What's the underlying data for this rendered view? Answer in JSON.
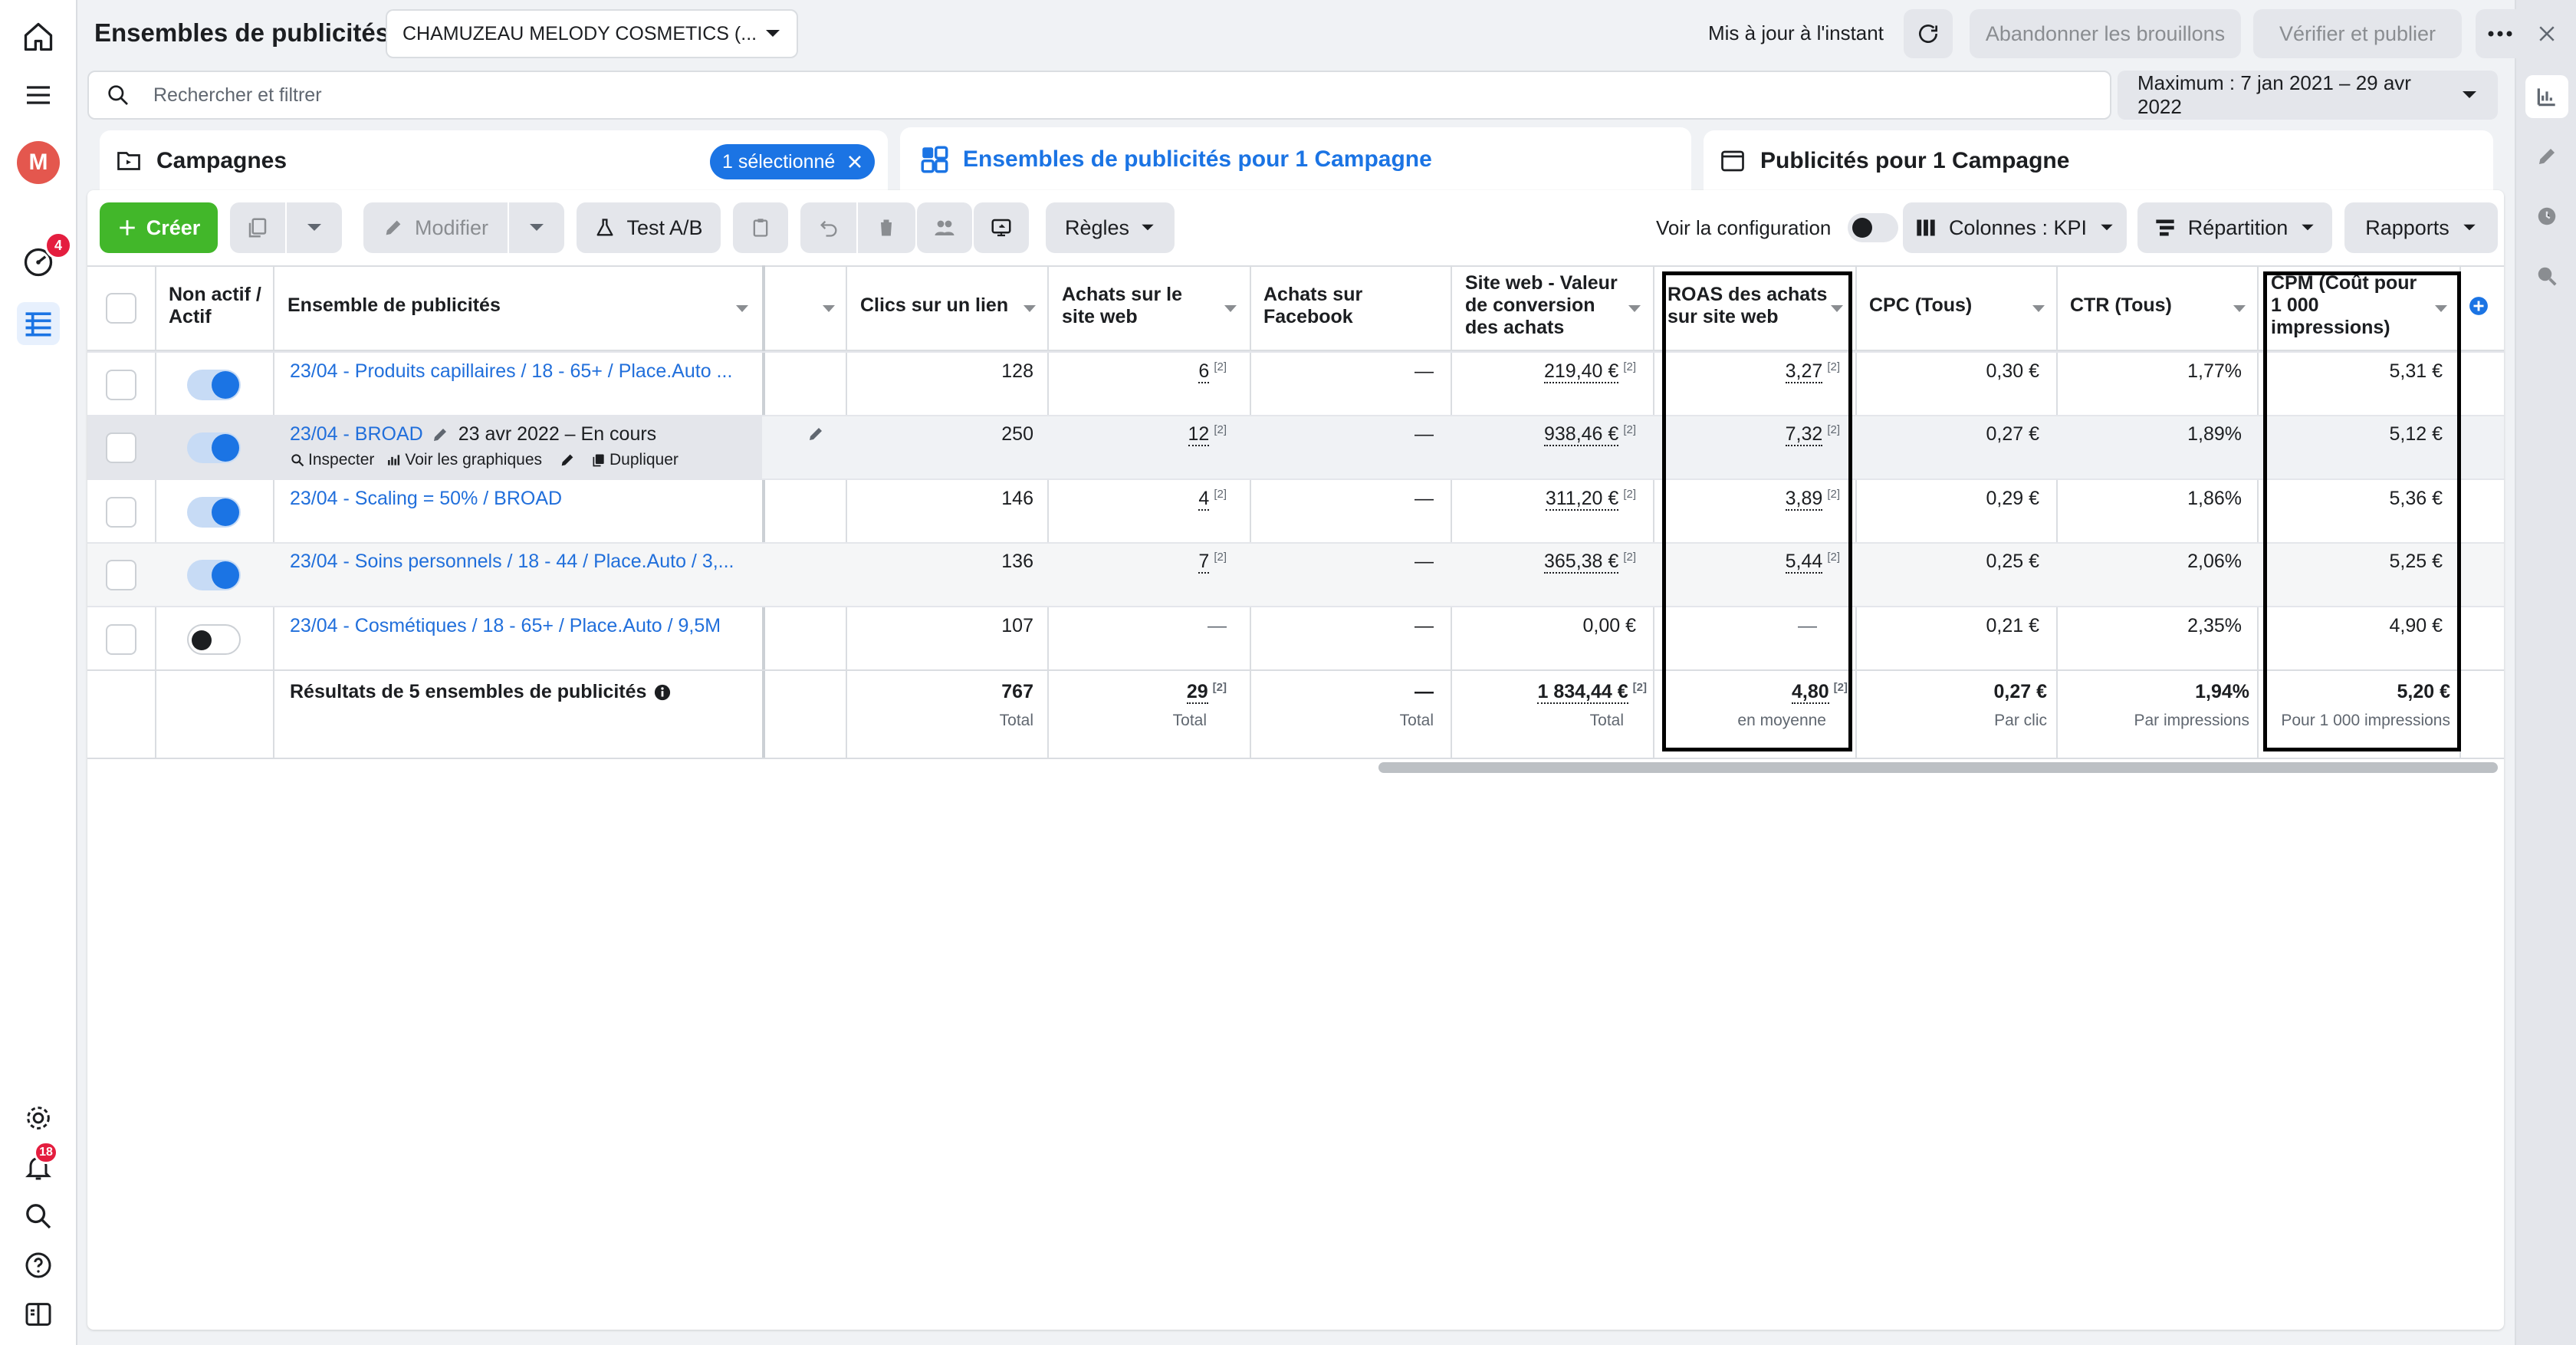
{
  "header": {
    "title": "Ensembles de publicités",
    "account": "CHAMUZEAU MELODY COSMETICS (...",
    "updated": "Mis à jour à l'instant",
    "discard": "Abandonner les brouillons",
    "review": "Vérifier et publier"
  },
  "search": {
    "placeholder": "Rechercher et filtrer",
    "date_range": "Maximum : 7 jan 2021 – 29 avr 2022"
  },
  "leftnav": {
    "avatar": "M",
    "badge_ads": "4",
    "badge_notif": "18"
  },
  "tabs": {
    "campaigns": "Campagnes",
    "selected_badge": "1 sélectionné",
    "adsets": "Ensembles de publicités pour 1 Campagne",
    "ads": "Publicités pour 1 Campagne"
  },
  "toolbar": {
    "create": "Créer",
    "edit": "Modifier",
    "abtest": "Test A/B",
    "rules": "Règles",
    "view_config": "Voir la configuration",
    "columns": "Colonnes : KPI",
    "breakdown": "Répartition",
    "reports": "Rapports"
  },
  "columns": {
    "status": "Non actif / Actif",
    "name": "Ensemble de publicités",
    "clicks": "Clics sur un lien",
    "purchases_web": "Achats sur le site web",
    "purchases_fb": "Achats sur Facebook",
    "conv_value": "Site web - Valeur de conversion des achats",
    "roas": "ROAS des achats sur site web",
    "cpc": "CPC (Tous)",
    "ctr": "CTR (Tous)",
    "cpm": "CPM (Coût pour 1 000 impressions)"
  },
  "rows": [
    {
      "name": "23/04 - Produits capillaires / 18 - 65+ / Place.Auto ...",
      "active": true,
      "clicks": "128",
      "purchases_web": "6",
      "purchases_fb": "—",
      "conv_value": "219,40 €",
      "roas": "3,27",
      "cpc": "0,30 €",
      "ctr": "1,77%",
      "cpm": "5,31 €"
    },
    {
      "name": "23/04 - BROAD",
      "date": "23 avr 2022 – En cours",
      "active": true,
      "clicks": "250",
      "purchases_web": "12",
      "purchases_fb": "—",
      "conv_value": "938,46 €",
      "roas": "7,32",
      "cpc": "0,27 €",
      "ctr": "1,89%",
      "cpm": "5,12 €"
    },
    {
      "name": "23/04 - Scaling = 50% / BROAD",
      "active": true,
      "clicks": "146",
      "purchases_web": "4",
      "purchases_fb": "—",
      "conv_value": "311,20 €",
      "roas": "3,89",
      "cpc": "0,29 €",
      "ctr": "1,86%",
      "cpm": "5,36 €"
    },
    {
      "name": "23/04 - Soins personnels / 18 - 44 / Place.Auto / 3,...",
      "active": true,
      "clicks": "136",
      "purchases_web": "7",
      "purchases_fb": "—",
      "conv_value": "365,38 €",
      "roas": "5,44",
      "cpc": "0,25 €",
      "ctr": "2,06%",
      "cpm": "5,25 €"
    },
    {
      "name": "23/04 - Cosmétiques / 18 - 65+ / Place.Auto / 9,5M",
      "active": false,
      "clicks": "107",
      "purchases_web": "—",
      "purchases_fb": "—",
      "conv_value": "0,00 €",
      "roas": "—",
      "cpc": "0,21 €",
      "ctr": "2,35%",
      "cpm": "4,90 €"
    }
  ],
  "row_actions": {
    "inspect": "Inspecter",
    "charts": "Voir les graphiques",
    "duplicate": "Dupliquer"
  },
  "footnote": "[2]",
  "totals": {
    "label": "Résultats de 5 ensembles de publicités",
    "clicks": "767",
    "clicks_sub": "Total",
    "purchases_web": "29",
    "purchases_web_sub": "Total",
    "purchases_fb": "—",
    "purchases_fb_sub": "Total",
    "conv_value": "1 834,44 €",
    "conv_value_sub": "Total",
    "roas": "4,80",
    "roas_sub": "en moyenne",
    "cpc": "0,27 €",
    "cpc_sub": "Par clic",
    "ctr": "1,94%",
    "ctr_sub": "Par impressions",
    "cpm": "5,20 €",
    "cpm_sub": "Pour 1 000 impressions"
  }
}
